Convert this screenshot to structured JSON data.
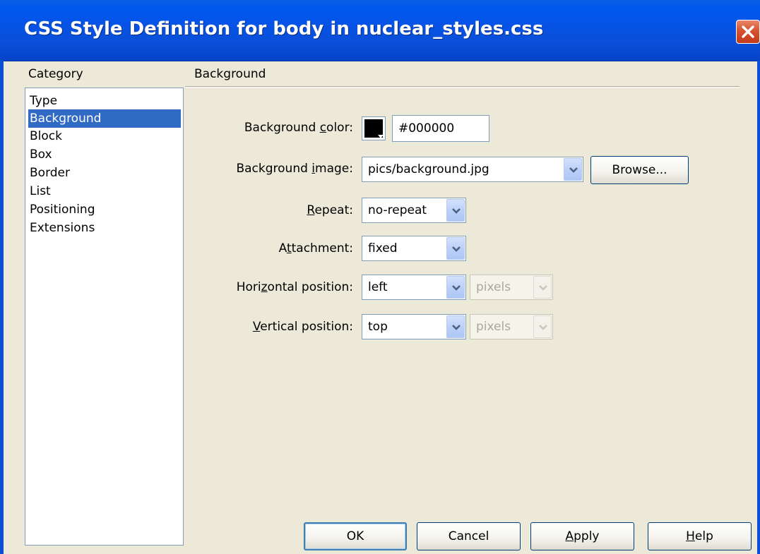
{
  "window": {
    "title": "CSS Style Definition for body in nuclear_styles.css",
    "close_icon": "close-icon"
  },
  "category": {
    "heading": "Category",
    "items": [
      "Type",
      "Background",
      "Block",
      "Box",
      "Border",
      "List",
      "Positioning",
      "Extensions"
    ],
    "selected": "Background"
  },
  "panel": {
    "heading": "Background",
    "background_color": {
      "label": "Background color:",
      "accesskey": "c",
      "value": "#000000",
      "swatch": "#000000"
    },
    "background_image": {
      "label": "Background image:",
      "accesskey": "i",
      "value": "pics/background.jpg",
      "browse_label": "Browse..."
    },
    "repeat": {
      "label": "Repeat:",
      "accesskey": "R",
      "value": "no-repeat"
    },
    "attachment": {
      "label": "Attachment:",
      "accesskey": "t",
      "value": "fixed"
    },
    "horizontal_position": {
      "label": "Horizontal position:",
      "accesskey": "z",
      "value": "left",
      "unit": "pixels"
    },
    "vertical_position": {
      "label": "Vertical position:",
      "accesskey": "V",
      "value": "top",
      "unit": "pixels"
    }
  },
  "buttons": {
    "ok": "OK",
    "cancel": "Cancel",
    "apply": "Apply",
    "help": "Help"
  },
  "colors": {
    "title_bar": "#0a4fd8",
    "dialog_bg": "#ece9d8",
    "selection": "#316ac5",
    "close_button": "#d8522f"
  }
}
